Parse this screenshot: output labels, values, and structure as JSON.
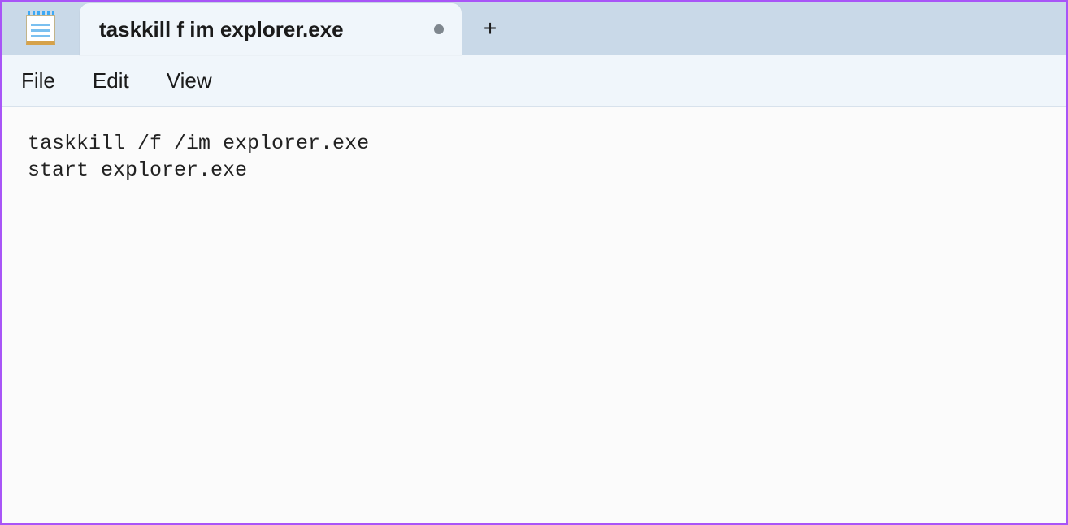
{
  "titlebar": {
    "tab_title": "taskkill f im explorer.exe",
    "tab_modified": true
  },
  "menubar": {
    "items": [
      "File",
      "Edit",
      "View"
    ]
  },
  "editor": {
    "lines": [
      "taskkill /f /im explorer.exe",
      "start explorer.exe"
    ]
  }
}
